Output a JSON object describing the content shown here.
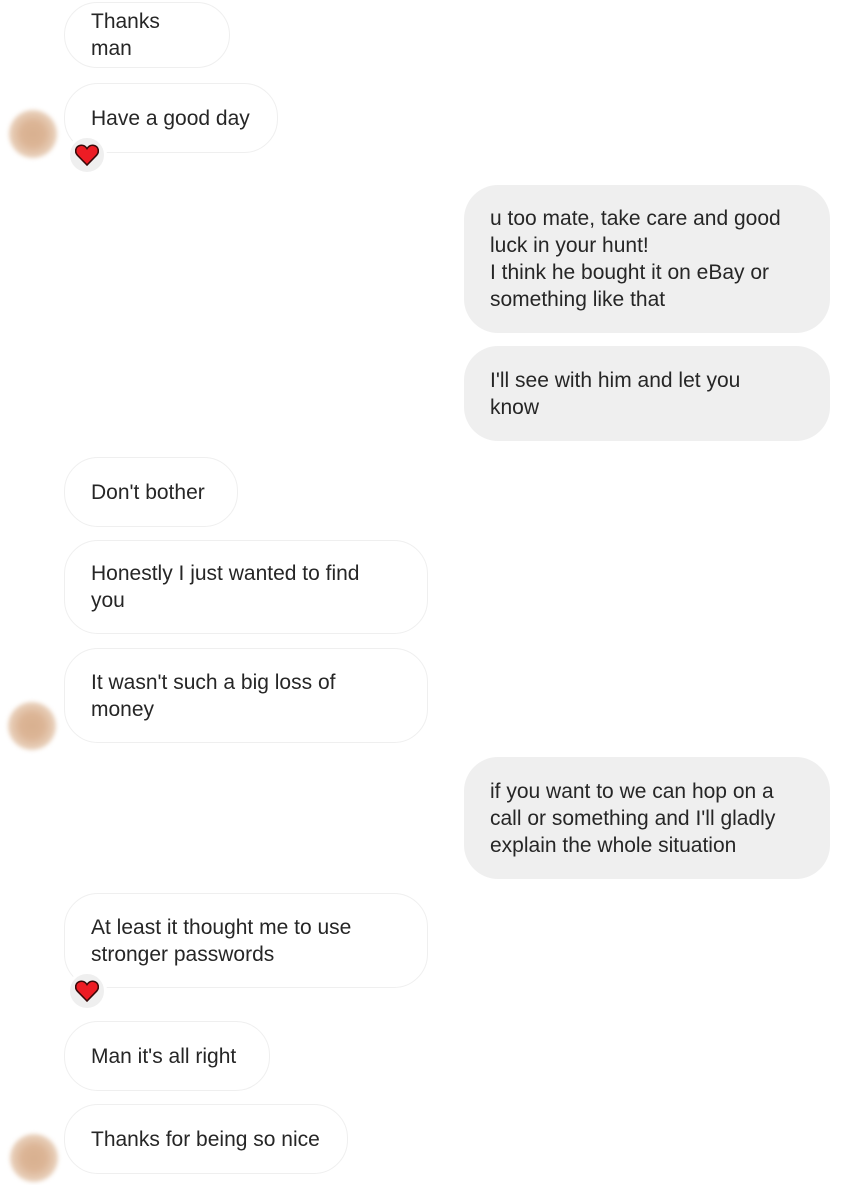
{
  "conversation": {
    "messages": [
      {
        "direction": "incoming",
        "text": "Thanks man"
      },
      {
        "direction": "incoming",
        "text": "Have a good day",
        "reaction": "heart-icon"
      },
      {
        "direction": "outgoing",
        "text": "u too mate, take care and good\nluck in your hunt!\nI think he bought it on eBay or\nsomething like that"
      },
      {
        "direction": "outgoing",
        "text": "I'll see with him and let you\nknow"
      },
      {
        "direction": "incoming",
        "text": "Don't bother"
      },
      {
        "direction": "incoming",
        "text": "Honestly I just wanted to find\nyou"
      },
      {
        "direction": "incoming",
        "text": "It wasn't such a big loss of\nmoney"
      },
      {
        "direction": "outgoing",
        "text": "if you want to we can hop on a\ncall or something and I'll gladly\nexplain the whole situation"
      },
      {
        "direction": "incoming",
        "text": "At least it thought me to use\nstronger passwords",
        "reaction": "heart-icon"
      },
      {
        "direction": "incoming",
        "text": "Man it's all right"
      },
      {
        "direction": "incoming",
        "text": "Thanks for being so nice"
      }
    ]
  },
  "colors": {
    "incoming_bubble": "#ffffff",
    "outgoing_bubble": "#efefef",
    "text": "#262626",
    "heart": "#ed1c24"
  }
}
